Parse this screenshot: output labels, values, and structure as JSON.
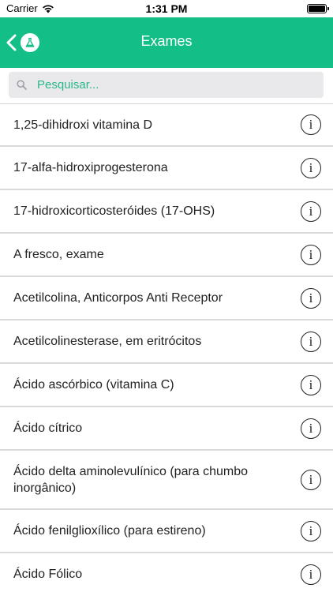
{
  "status_bar": {
    "carrier": "Carrier",
    "time": "1:31 PM"
  },
  "nav": {
    "title": "Exames",
    "accent_color": "#14bf87"
  },
  "search": {
    "placeholder": "Pesquisar..."
  },
  "list": {
    "items": [
      {
        "label": "1,25-dihidroxi vitamina D",
        "info_glyph": "i"
      },
      {
        "label": "17-alfa-hidroxiprogesterona",
        "info_glyph": "i"
      },
      {
        "label": "17-hidroxicorticosteróides (17-OHS)",
        "info_glyph": "i"
      },
      {
        "label": "A fresco, exame",
        "info_glyph": "i"
      },
      {
        "label": "Acetilcolina, Anticorpos Anti Receptor",
        "info_glyph": "i"
      },
      {
        "label": "Acetilcolinesterase, em eritrócitos",
        "info_glyph": "i"
      },
      {
        "label": "Ácido ascórbico (vitamina C)",
        "info_glyph": "i"
      },
      {
        "label": "Ácido cítrico",
        "info_glyph": "i"
      },
      {
        "label": "Ácido delta aminolevulínico (para chumbo inorgânico)",
        "info_glyph": "i"
      },
      {
        "label": "Ácido fenilglioxílico (para estireno)",
        "info_glyph": "i"
      },
      {
        "label": "Ácido Fólico",
        "info_glyph": "i"
      }
    ]
  }
}
